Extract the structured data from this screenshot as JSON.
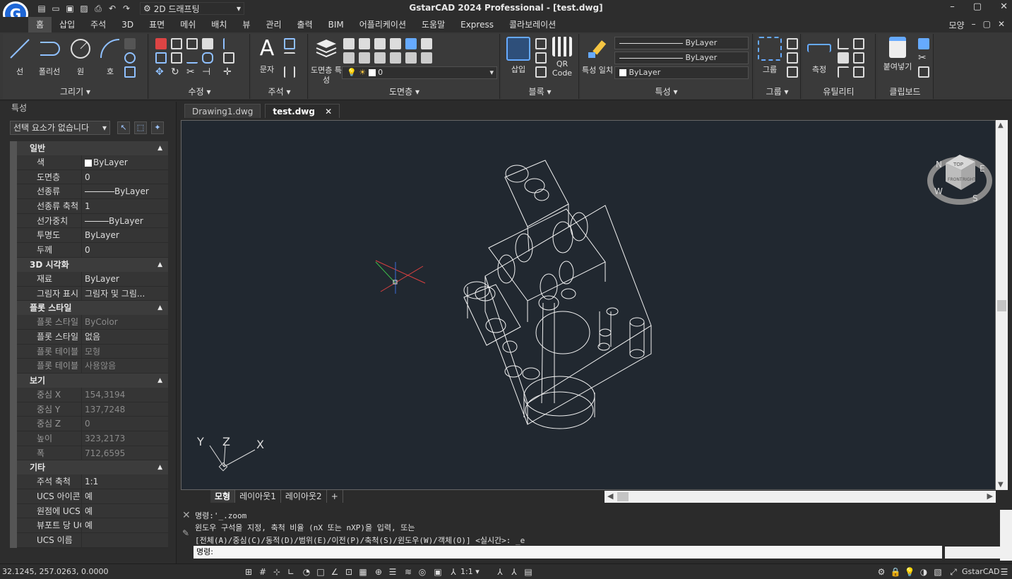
{
  "app": {
    "title": "GstarCAD 2024 Professional - [test.dwg]",
    "logo_letter": "G",
    "workspace": "2D 드래프팅",
    "menu_right": {
      "view_label": "모양",
      "min": "–",
      "restore": "▢",
      "close": "✕"
    }
  },
  "menu": {
    "items": [
      "홈",
      "삽입",
      "주석",
      "3D",
      "표면",
      "메쉬",
      "배치",
      "뷰",
      "관리",
      "출력",
      "BIM",
      "어플리케이션",
      "도움말",
      "Express",
      "콜라보레이션"
    ]
  },
  "ribbon": {
    "draw": {
      "title": "그리기",
      "line": "선",
      "polyline": "폴리선",
      "circle": "원",
      "arc": "호"
    },
    "modify": {
      "title": "수정"
    },
    "annotation": {
      "title": "주석",
      "text": "문자"
    },
    "layers": {
      "title": "도면층",
      "props": "도면층 특성",
      "current_layer": "0"
    },
    "block": {
      "title": "블록",
      "insert": "삽입",
      "qr": "QR Code"
    },
    "properties": {
      "title": "특성",
      "match": "특성 일치",
      "linetype": "ByLayer",
      "lineweight": "ByLayer",
      "color": "ByLayer"
    },
    "group": {
      "title": "그룹",
      "group": "그룹"
    },
    "utilities": {
      "title": "유틸리티",
      "measure": "측정"
    },
    "clipboard": {
      "title": "클립보드",
      "paste": "붙여넣기"
    }
  },
  "doc_tabs": [
    {
      "label": "Drawing1.dwg"
    },
    {
      "label": "test.dwg"
    }
  ],
  "properties_panel": {
    "header": "특성",
    "selection": "선택 요소가 없습니다",
    "sections": {
      "general": {
        "title": "일반",
        "rows": [
          {
            "label": "색",
            "value": "ByLayer"
          },
          {
            "label": "도면층",
            "value": "0"
          },
          {
            "label": "선종류",
            "value": "ByLayer"
          },
          {
            "label": "선종류 축척",
            "value": "1"
          },
          {
            "label": "선가중치",
            "value": "ByLayer"
          },
          {
            "label": "투명도",
            "value": "ByLayer"
          },
          {
            "label": "두께",
            "value": "0"
          }
        ]
      },
      "visual3d": {
        "title": "3D 시각화",
        "rows": [
          {
            "label": "재료",
            "value": "ByLayer"
          },
          {
            "label": "그림자 표시",
            "value": "그림자 및 그림..."
          }
        ]
      },
      "plotstyle": {
        "title": "플롯 스타일",
        "rows": [
          {
            "label": "플롯 스타일",
            "value": "ByColor"
          },
          {
            "label": "플롯 스타일 ...",
            "value": "없음"
          },
          {
            "label": "플롯 테이블 ...",
            "value": "모형"
          },
          {
            "label": "플롯 테이블 ...",
            "value": "사용않음"
          }
        ]
      },
      "view": {
        "title": "보기",
        "rows": [
          {
            "label": "중심 X",
            "value": "154,3194"
          },
          {
            "label": "중심 Y",
            "value": "137,7248"
          },
          {
            "label": "중심 Z",
            "value": "0"
          },
          {
            "label": "높이",
            "value": "323,2173"
          },
          {
            "label": "폭",
            "value": "712,6595"
          }
        ]
      },
      "misc": {
        "title": "기타",
        "rows": [
          {
            "label": "주석 축척",
            "value": "1:1"
          },
          {
            "label": "UCS 아이콘 ...",
            "value": "예"
          },
          {
            "label": "원점에 UCS ...",
            "value": "예"
          },
          {
            "label": "뷰포트 당 UCS",
            "value": "예"
          },
          {
            "label": "UCS 이름",
            "value": ""
          }
        ]
      }
    }
  },
  "viewcube": {
    "top": "TOP",
    "front": "FRONT",
    "right": "RIGHT",
    "n": "N",
    "e": "E",
    "w": "W",
    "s": "S"
  },
  "ucs": {
    "x": "X",
    "y": "Y",
    "z": "Z"
  },
  "layout_tabs": [
    "모형",
    "레이아웃1",
    "레이아웃2",
    "+"
  ],
  "command": {
    "line1": "명령:'_.zoom",
    "line2": "윈도우 구석을 지정, 축척 비율 (nX 또는 nXP)을 입력, 또는",
    "line3": "[전체(A)/중심(C)/동적(D)/범위(E)/이전(P)/축척(S)/윈도우(W)/객체(O)] <실시간>: _e",
    "prompt": "명령:"
  },
  "status": {
    "coords": "32.1245, 257.0263, 0.0000",
    "scale": "1:1",
    "brand": "GstarCAD"
  }
}
